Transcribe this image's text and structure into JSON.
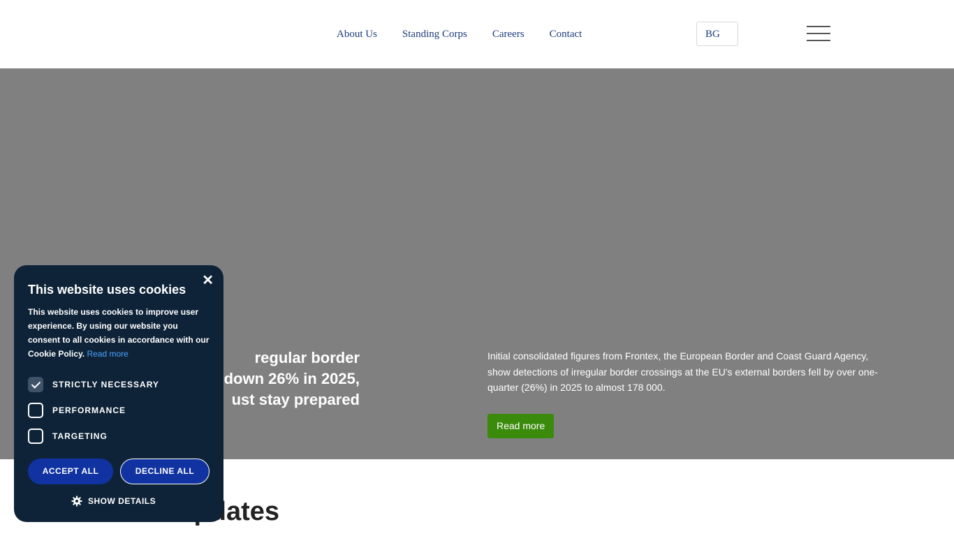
{
  "header": {
    "nav": [
      "About Us",
      "Standing Corps",
      "Careers",
      "Contact"
    ],
    "lang": "BG"
  },
  "hero": {
    "title_lines": [
      "regular border",
      "down 26% in 2025,",
      "ust stay prepared"
    ],
    "text": "Initial consolidated figures from Frontex, the European Border and Coast Guard Agency, show detections of irregular border crossings at the EU's external borders fell by over one-quarter (26%) in 2025 to almost 178 000.",
    "read_more": "Read more"
  },
  "section_heading": "pdates",
  "cookie": {
    "close": "✕",
    "title": "This website uses cookies",
    "description": "This website uses cookies to improve user experience. By using our website you consent to all cookies in accordance with our Cookie Policy.",
    "read_more": "Read more",
    "options": [
      {
        "label": "STRICTLY NECESSARY",
        "checked": true
      },
      {
        "label": "PERFORMANCE",
        "checked": false
      },
      {
        "label": "TARGETING",
        "checked": false
      }
    ],
    "accept_all": "ACCEPT ALL",
    "decline_all": "DECLINE ALL",
    "show_details": "SHOW DETAILS",
    "show_details_icon": "gear-icon"
  },
  "colors": {
    "hero_bg": "#808080",
    "cookie_bg": "#0e2338",
    "button_blue": "#1033a1",
    "read_more_green": "#3a8a0c",
    "nav_text": "#1b3a7a"
  }
}
